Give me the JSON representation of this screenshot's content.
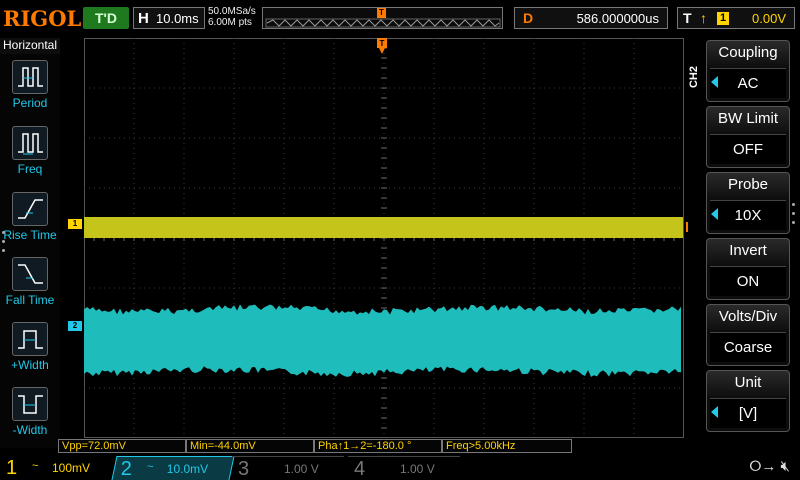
{
  "brand": "RIGOL",
  "run_state": "T'D",
  "horizontal": {
    "label": "H",
    "timebase": "10.0ms",
    "sample_rate": "50.0MSa/s",
    "memory": "6.00M pts"
  },
  "delay": {
    "label": "D",
    "value": "586.000000us"
  },
  "trigger": {
    "label": "T",
    "edge_icon": "rising-edge-icon",
    "source": "1",
    "level": "0.00V"
  },
  "left_panel": {
    "title": "Horizontal",
    "items": [
      {
        "label": "Period",
        "icon": "period-icon"
      },
      {
        "label": "Freq",
        "icon": "frequency-icon"
      },
      {
        "label": "Rise Time",
        "icon": "rise-time-icon"
      },
      {
        "label": "Fall Time",
        "icon": "fall-time-icon"
      },
      {
        "label": "+Width",
        "icon": "positive-width-icon"
      },
      {
        "label": "-Width",
        "icon": "negative-width-icon"
      }
    ]
  },
  "right_menu": {
    "channel": "CH2",
    "items": [
      {
        "title": "Coupling",
        "value": "AC",
        "arrow": true
      },
      {
        "title": "BW Limit",
        "value": "OFF",
        "arrow": false
      },
      {
        "title": "Probe",
        "value": "10X",
        "arrow": true
      },
      {
        "title": "Invert",
        "value": "ON",
        "arrow": false
      },
      {
        "title": "Volts/Div",
        "value": "Coarse",
        "arrow": false
      },
      {
        "title": "Unit",
        "value": "[V]",
        "arrow": true
      }
    ]
  },
  "markers": {
    "ch1": "1",
    "ch2": "2",
    "trigger_level": "T",
    "trigger_position": "T"
  },
  "measurements": [
    {
      "text": "Vpp=72.0mV"
    },
    {
      "text": "Min=-44.0mV"
    },
    {
      "text": "Pha↑1→2=-180.0 °"
    },
    {
      "text": "Freq>5.00kHz"
    }
  ],
  "channels": [
    {
      "num": "1",
      "coupling": "~",
      "scale": "100mV",
      "enabled": true,
      "color": "#ffd400"
    },
    {
      "num": "2",
      "coupling": "~",
      "scale": "10.0mV",
      "enabled": true,
      "color": "#21c8e8"
    },
    {
      "num": "3",
      "coupling": "",
      "scale": "1.00 V",
      "enabled": false,
      "color": "#777777"
    },
    {
      "num": "4",
      "coupling": "",
      "scale": "1.00 V",
      "enabled": false,
      "color": "#777777"
    }
  ],
  "status_icons": [
    "usb-icon",
    "speaker-muted-icon"
  ],
  "colors": {
    "ch1": "#ffd400",
    "ch2": "#21c8e8",
    "accent": "#ff7a00"
  }
}
